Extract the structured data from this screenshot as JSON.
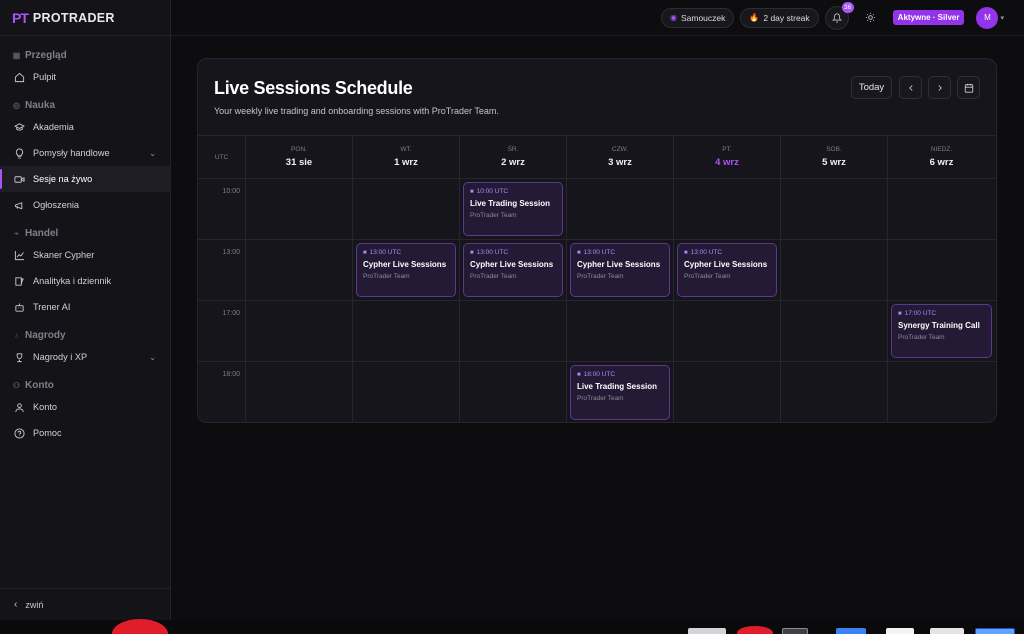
{
  "brand": {
    "mark": "PT",
    "name": "PROTRADER"
  },
  "sidebar": {
    "sections": [
      {
        "title": "Przegląd",
        "items": [
          {
            "label": "Pulpit",
            "icon": "home-icon"
          }
        ]
      },
      {
        "title": "Nauka",
        "items": [
          {
            "label": "Akademia",
            "icon": "graduation-cap-icon"
          },
          {
            "label": "Pomysły handlowe",
            "icon": "lightbulb-icon",
            "expandable": true
          },
          {
            "label": "Sesje na żywo",
            "icon": "video-icon",
            "active": true
          },
          {
            "label": "Ogłoszenia",
            "icon": "megaphone-icon"
          }
        ]
      },
      {
        "title": "Handel",
        "items": [
          {
            "label": "Skaner Cypher",
            "icon": "chart-line-icon"
          },
          {
            "label": "Analityka i dziennik",
            "icon": "journal-icon"
          },
          {
            "label": "Trener AI",
            "icon": "robot-icon"
          }
        ]
      },
      {
        "title": "Nagrody",
        "items": [
          {
            "label": "Nagrody i XP",
            "icon": "trophy-icon",
            "expandable": true
          }
        ]
      },
      {
        "title": "Konto",
        "items": [
          {
            "label": "Konto",
            "icon": "user-icon"
          },
          {
            "label": "Pomoc",
            "icon": "help-circle-icon"
          }
        ]
      }
    ],
    "collapse_label": "zwiń"
  },
  "topbar": {
    "tutorial_label": "Samouczek",
    "streak_label": "2 day streak",
    "notifications_count": "36",
    "plan_label": "Aktywne · Silver",
    "avatar_initial": "M"
  },
  "schedule": {
    "title": "Live Sessions Schedule",
    "subtitle": "Your weekly live trading and onboarding sessions with ProTrader Team.",
    "today_label": "Today",
    "tz_label": "UTC",
    "days": [
      {
        "name": "PON.",
        "date": "31 sie"
      },
      {
        "name": "WT.",
        "date": "1 wrz"
      },
      {
        "name": "ŚR.",
        "date": "2 wrz"
      },
      {
        "name": "CZW.",
        "date": "3 wrz"
      },
      {
        "name": "PT.",
        "date": "4 wrz",
        "today": true
      },
      {
        "name": "SOB.",
        "date": "5 wrz"
      },
      {
        "name": "NIEDZ.",
        "date": "6 wrz"
      }
    ],
    "rows": [
      {
        "time": "10:00",
        "events": [
          {
            "day": 2,
            "time": "10:00 UTC",
            "title": "Live Trading Session",
            "host": "ProTrader Team"
          }
        ]
      },
      {
        "time": "13:00",
        "events": [
          {
            "day": 1,
            "time": "13:00 UTC",
            "title": "Cypher Live Sessions",
            "host": "ProTrader Team"
          },
          {
            "day": 2,
            "time": "13:00 UTC",
            "title": "Cypher Live Sessions",
            "host": "ProTrader Team"
          },
          {
            "day": 3,
            "time": "13:00 UTC",
            "title": "Cypher Live Sessions",
            "host": "ProTrader Team"
          },
          {
            "day": 4,
            "time": "13:00 UTC",
            "title": "Cypher Live Sessions",
            "host": "ProTrader Team"
          }
        ]
      },
      {
        "time": "17:00",
        "events": [
          {
            "day": 6,
            "time": "17:00 UTC",
            "title": "Synergy Training Call",
            "host": "ProTrader Team"
          }
        ]
      },
      {
        "time": "18:00",
        "events": [
          {
            "day": 3,
            "time": "18:00 UTC",
            "title": "Live Trading Session",
            "host": "ProTrader Team"
          }
        ]
      }
    ]
  },
  "colors": {
    "accent": "#a855f7",
    "event_bg": "#241a35",
    "event_border": "#5b3a8c"
  }
}
